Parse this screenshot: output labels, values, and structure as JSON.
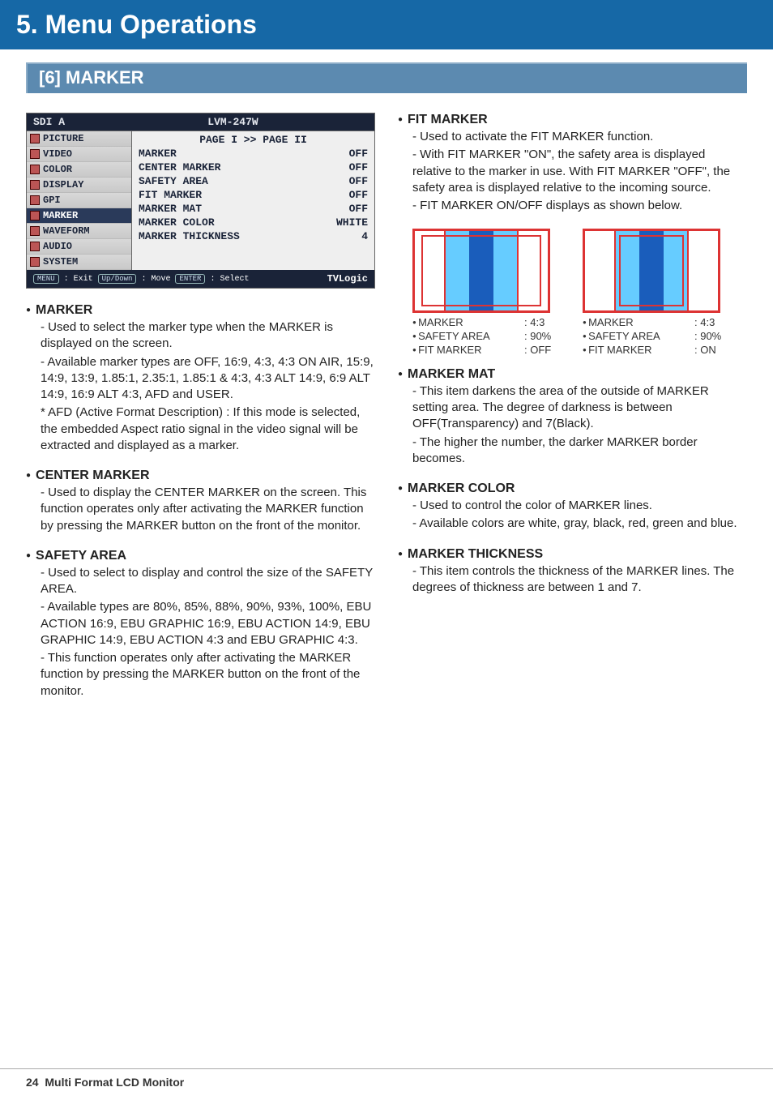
{
  "header": {
    "title": "5. Menu Operations",
    "section": "[6] MARKER"
  },
  "osd": {
    "source": "SDI A",
    "model": "LVM-247W",
    "page_header": "PAGE I >> PAGE II",
    "tabs": [
      "PICTURE",
      "VIDEO",
      "COLOR",
      "DISPLAY",
      "GPI",
      "MARKER",
      "WAVEFORM",
      "AUDIO",
      "SYSTEM"
    ],
    "active_tab": "MARKER",
    "rows": [
      {
        "label": "MARKER",
        "value": "OFF"
      },
      {
        "label": "CENTER MARKER",
        "value": "OFF"
      },
      {
        "label": "SAFETY AREA",
        "value": "OFF"
      },
      {
        "label": "FIT MARKER",
        "value": "OFF"
      },
      {
        "label": "MARKER MAT",
        "value": "OFF"
      },
      {
        "label": "MARKER COLOR",
        "value": "WHITE"
      },
      {
        "label": "MARKER THICKNESS",
        "value": "4"
      }
    ],
    "foot_menu": "MENU",
    "foot_exit": ": Exit",
    "foot_ud": "Up/Down",
    "foot_move": ": Move",
    "foot_enter": "ENTER",
    "foot_select": ": Select",
    "brand": "TVLogic"
  },
  "left_items": [
    {
      "title": "MARKER",
      "paras": [
        "- Used to select the marker type when the MARKER is displayed on the screen.",
        "- Available marker types are OFF, 16:9, 4:3, 4:3 ON AIR, 15:9, 14:9, 13:9, 1.85:1, 2.35:1, 1.85:1 & 4:3, 4:3 ALT 14:9, 6:9 ALT 14:9, 16:9 ALT 4:3, AFD and USER.",
        "* AFD (Active Format Description) : If this mode is selected,  the embedded Aspect ratio signal in the video signal will be extracted and displayed as a marker."
      ]
    },
    {
      "title": "CENTER MARKER",
      "paras": [
        "- Used to display the CENTER MARKER on the screen. This function operates only after activating the MARKER function by pressing the MARKER button on the front of the monitor."
      ]
    },
    {
      "title": "SAFETY AREA",
      "paras": [
        "- Used to select to display and control the size of the SAFETY AREA.",
        "- Available types are 80%, 85%, 88%, 90%, 93%, 100%, EBU ACTION 16:9, EBU GRAPHIC 16:9, EBU ACTION 14:9, EBU GRAPHIC 14:9, EBU ACTION 4:3 and EBU GRAPHIC 4:3.",
        "- This function operates only after activating the MARKER function by pressing the MARKER button on the front of the monitor."
      ]
    }
  ],
  "right_items_top": {
    "title": "FIT MARKER",
    "paras": [
      "- Used to activate the FIT MARKER function.",
      "- With FIT MARKER \"ON\", the safety area is displayed relative to the marker in use. With FIT MARKER \"OFF\", the safety area is displayed relative to the incoming source.",
      "- FIT MARKER ON/OFF displays as shown below."
    ]
  },
  "diagrams": {
    "labels": {
      "marker": "MARKER",
      "safety": "SAFETY AREA",
      "fit": "FIT MARKER"
    },
    "left": {
      "marker": ": 4:3",
      "safety": ": 90%",
      "fit": ": OFF"
    },
    "right": {
      "marker": ": 4:3",
      "safety": ": 90%",
      "fit": ": ON"
    }
  },
  "right_items_rest": [
    {
      "title": "MARKER MAT",
      "paras": [
        "- This item darkens the area of the outside of MARKER setting area. The degree of darkness is between OFF(Transparency) and 7(Black).",
        "- The higher the number, the darker MARKER border becomes."
      ]
    },
    {
      "title": "MARKER COLOR",
      "paras": [
        "- Used to control the color of MARKER lines.",
        "- Available colors are white, gray, black, red, green and blue."
      ]
    },
    {
      "title": "MARKER THICKNESS",
      "paras": [
        "- This item controls the thickness of the MARKER lines. The degrees of thickness are between 1 and 7."
      ]
    }
  ],
  "footer": {
    "page": "24",
    "label": "Multi Format LCD Monitor"
  }
}
